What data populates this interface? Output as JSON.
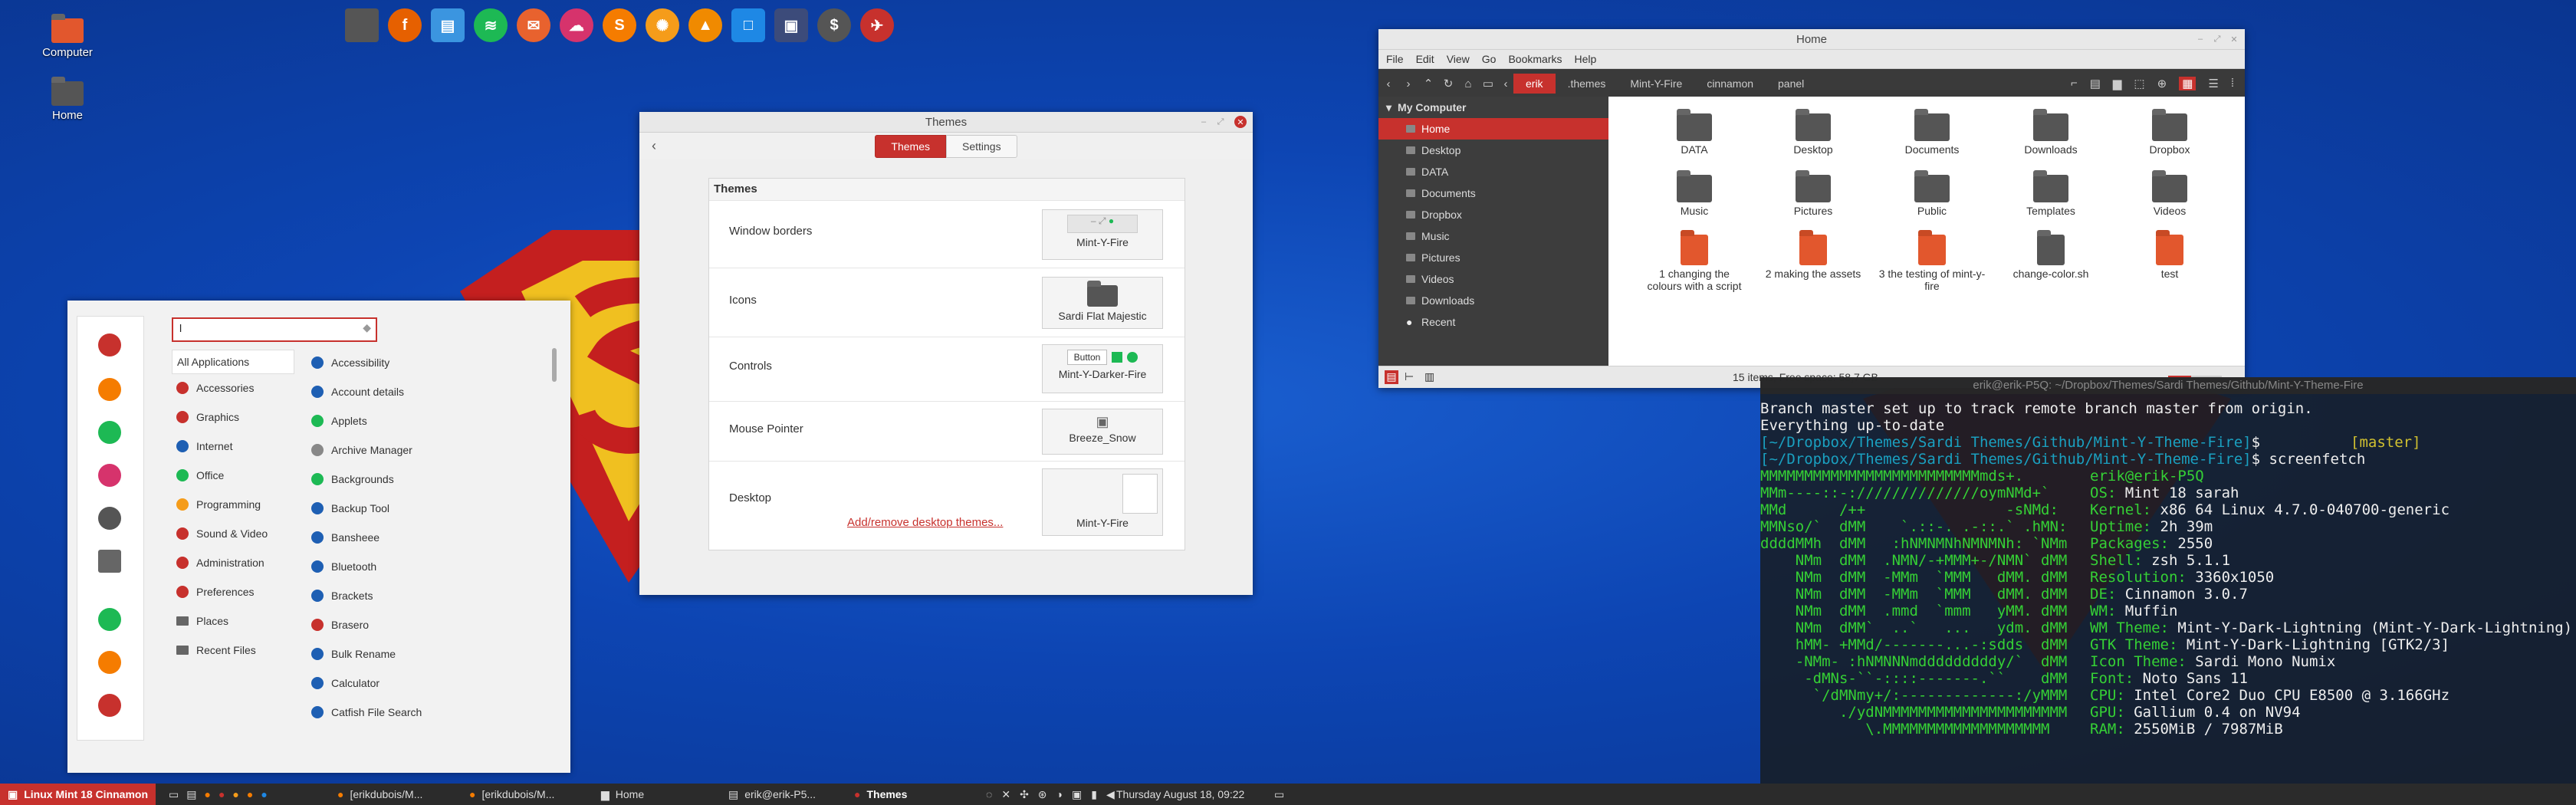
{
  "desktop": {
    "icons": [
      {
        "label": "Computer"
      },
      {
        "label": "Home"
      }
    ]
  },
  "colors": {
    "accent": "#c7312d",
    "panel": "#2b2b2b",
    "wallpaper": "#1356c4",
    "sidebar": "#3d3d3d"
  },
  "dock": {
    "items": [
      "files-icon",
      "firefox-icon",
      "docs-icon",
      "spotify-icon",
      "thunderbird-icon",
      "pidgin-icon",
      "sublime-icon",
      "orange-icon",
      "vlc-icon",
      "box-icon",
      "screenshot-icon",
      "terminal-dollar-icon",
      "transmission-icon"
    ]
  },
  "themes_window": {
    "title": "Themes",
    "tabs": [
      "Themes",
      "Settings"
    ],
    "section": "Themes",
    "rows": [
      {
        "label": "Window borders",
        "value": "Mint-Y-Fire"
      },
      {
        "label": "Icons",
        "value": "Sardi Flat Majestic"
      },
      {
        "label": "Controls",
        "value": "Mint-Y-Darker-Fire",
        "button": "Button"
      },
      {
        "label": "Mouse Pointer",
        "value": "Breeze_Snow"
      },
      {
        "label": "Desktop",
        "value": "Mint-Y-Fire"
      }
    ],
    "link": "Add/remove desktop themes..."
  },
  "file_manager": {
    "title": "Home",
    "menu": [
      "File",
      "Edit",
      "View",
      "Go",
      "Bookmarks",
      "Help"
    ],
    "breadcrumbs": [
      "erik",
      ".themes",
      "Mint-Y-Fire",
      "cinnamon",
      "panel"
    ],
    "sidebar_header": "My Computer",
    "sidebar": [
      "Home",
      "Desktop",
      "DATA",
      "Documents",
      "Dropbox",
      "Music",
      "Pictures",
      "Videos",
      "Downloads",
      "Recent"
    ],
    "files": [
      {
        "name": "DATA"
      },
      {
        "name": "Desktop"
      },
      {
        "name": "Documents"
      },
      {
        "name": "Downloads"
      },
      {
        "name": "Dropbox"
      },
      {
        "name": "Music"
      },
      {
        "name": "Pictures"
      },
      {
        "name": "Public"
      },
      {
        "name": "Templates"
      },
      {
        "name": "Videos"
      },
      {
        "name": "1 changing the colours with a script"
      },
      {
        "name": "2 making the assets"
      },
      {
        "name": "3 the testing of mint-y-fire"
      },
      {
        "name": "change-color.sh"
      },
      {
        "name": "test"
      }
    ],
    "status": "15 items, Free space: 58,7 GB"
  },
  "terminal": {
    "title": "erik@erik-P5Q: ~/Dropbox/Themes/Sardi Themes/Github/Mint-Y-Theme-Fire",
    "line1": "Branch master set up to track remote branch master from origin.",
    "line2": "Everything up-to-date",
    "prompt_path": "[~/Dropbox/Themes/Sardi Themes/Github/Mint-Y-Theme-Fire]",
    "branch": "[master]",
    "command": "screenfetch",
    "user_host": "erik@erik-P5Q",
    "info": [
      [
        "OS:",
        "Mint 18 sarah"
      ],
      [
        "Kernel:",
        "x86 64 Linux 4.7.0-040700-generic"
      ],
      [
        "Uptime:",
        "2h 39m"
      ],
      [
        "Packages:",
        "2550"
      ],
      [
        "Shell:",
        "zsh 5.1.1"
      ],
      [
        "Resolution:",
        "3360x1050"
      ],
      [
        "DE:",
        "Cinnamon 3.0.7"
      ],
      [
        "WM:",
        "Muffin"
      ],
      [
        "WM Theme:",
        "Mint-Y-Dark-Lightning (Mint-Y-Dark-Lightning)"
      ],
      [
        "GTK Theme:",
        "Mint-Y-Dark-Lightning [GTK2/3]"
      ],
      [
        "Icon Theme:",
        "Sardi Mono Numix"
      ],
      [
        "Font:",
        "Noto Sans 11"
      ],
      [
        "CPU:",
        "Intel Core2 Duo CPU E8500 @ 3.166GHz"
      ],
      [
        "GPU:",
        "Gallium 0.4 on NV94"
      ],
      [
        "RAM:",
        "2550MiB / 7987MiB"
      ]
    ],
    "logo": [
      "MMMMMMMMMMMMMMMMMMMMMMMMMmds+.",
      "MMm----::-://////////////oymNMd+`",
      "MMd      /++                -sNMd:",
      "MMNso/`  dMM    `.::-. .-::.` .hMN:",
      "ddddMMh  dMM   :hNMNMNhNMNMNh: `NMm",
      "    NMm  dMM  .NMN/-+MMM+-/NMN` dMM",
      "    NMm  dMM  -MMm  `MMM   dMM. dMM",
      "    NMm  dMM  -MMm  `MMM   dMM. dMM",
      "    NMm  dMM  .mmd  `mmm   yMM. dMM",
      "    NMm  dMM`  ..`   ...   ydm. dMM",
      "    hMM- +MMd/-------...-:sdds  dMM",
      "    -NMm- :hNMNNNmdddddddddy/`  dMM",
      "     -dMNs-``-::::-------.``    dMM",
      "      `/dMNmy+/:-------------:/yMMM",
      "         ./ydNMMMMMMMMMMMMMMMMMMMMM",
      "            \\.MMMMMMMMMMMMMMMMMMM"
    ]
  },
  "start_menu": {
    "search_value": "l",
    "categories": [
      "All Applications",
      "Accessories",
      "Graphics",
      "Internet",
      "Office",
      "Programming",
      "Sound & Video",
      "Administration",
      "Preferences",
      "Places",
      "Recent Files"
    ],
    "apps": [
      "Accessibility",
      "Account details",
      "Applets",
      "Archive Manager",
      "Backgrounds",
      "Backup Tool",
      "Bansheee",
      "Bluetooth",
      "Brackets",
      "Brasero",
      "Bulk Rename",
      "Calculator",
      "Catfish File Search"
    ]
  },
  "panel": {
    "menu_label": "Linux Mint 18 Cinnamon",
    "tasks": [
      "[erikdubois/M...",
      "[erikdubois/M...",
      "Home",
      "erik@erik-P5...",
      "Themes"
    ],
    "clock": "Thursday August 18, 09:22"
  }
}
